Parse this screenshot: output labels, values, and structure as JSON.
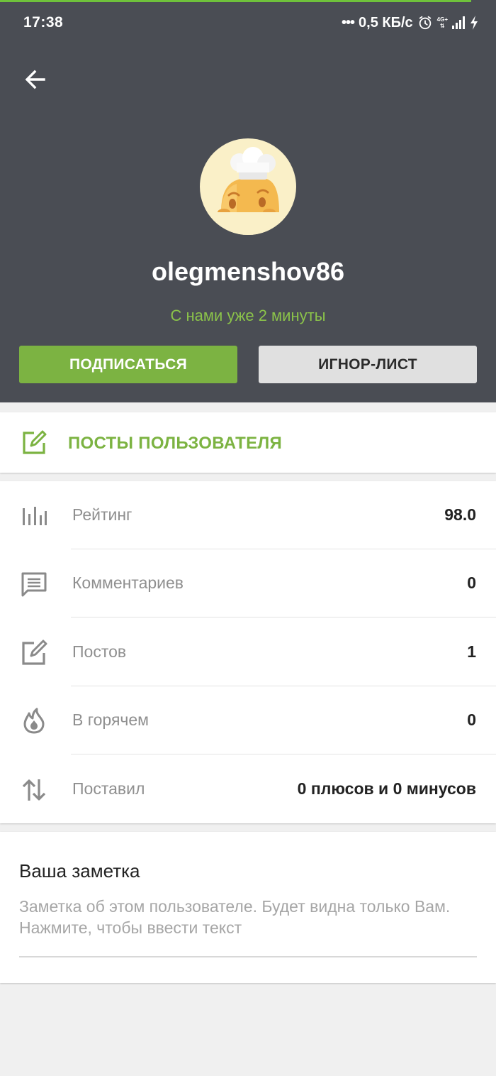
{
  "status_bar": {
    "time": "17:38",
    "network_speed": "0,5 КБ/с",
    "network_type": "4G+",
    "icons": [
      "more-dots-icon",
      "alarm-icon",
      "signal-icon",
      "charging-icon"
    ]
  },
  "profile": {
    "username": "olegmenshov86",
    "member_since": "С нами уже 2 минуты",
    "avatar_icon": "chef-avatar-icon"
  },
  "actions": {
    "subscribe_label": "ПОДПИСАТЬСЯ",
    "ignore_label": "ИГНОР-ЛИСТ"
  },
  "posts_link": {
    "label": "ПОСТЫ ПОЛЬЗОВАТЕЛЯ",
    "icon": "edit-icon"
  },
  "stats": [
    {
      "label": "Рейтинг",
      "value": "98.0",
      "icon": "bar-chart-icon"
    },
    {
      "label": "Комментариев",
      "value": "0",
      "icon": "comment-icon"
    },
    {
      "label": "Постов",
      "value": "1",
      "icon": "edit-icon"
    },
    {
      "label": "В горячем",
      "value": "0",
      "icon": "flame-icon"
    },
    {
      "label": "Поставил",
      "value": "0 плюсов и 0 минусов",
      "icon": "up-down-arrows-icon"
    }
  ],
  "note": {
    "title": "Ваша заметка",
    "placeholder": "Заметка об этом пользователе. Будет видна только Вам. Нажмите, чтобы ввести текст"
  },
  "colors": {
    "header_bg": "#4a4d54",
    "accent_green": "#7cb342",
    "since_green": "#8bc34a",
    "page_bg": "#f0f0f0"
  }
}
